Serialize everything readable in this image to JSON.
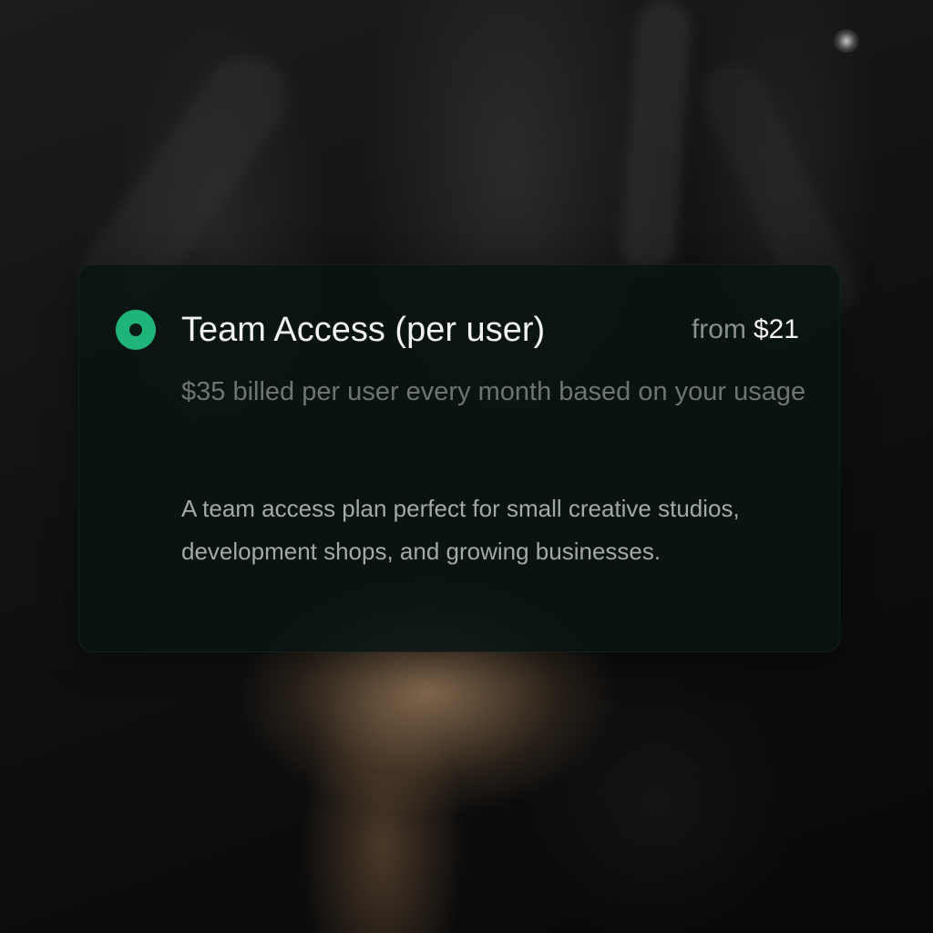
{
  "plan": {
    "name": "Team Access (per user)",
    "price_prefix": "from",
    "price": "$21",
    "billing": "$35 billed per user every month based on your usage",
    "description": "A team access plan perfect for small creative studios, development shops, and growing businesses.",
    "selected": true,
    "selected_icon": "radio-selected-icon",
    "accent_color": "#1fb47a"
  }
}
